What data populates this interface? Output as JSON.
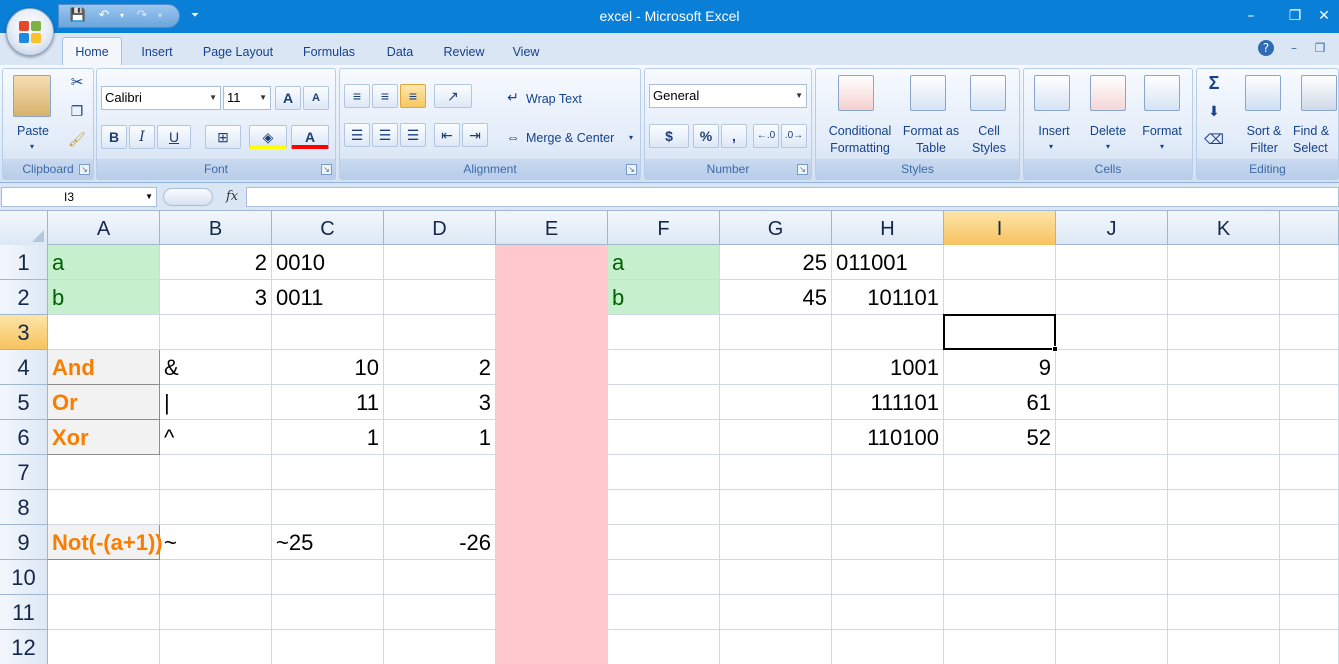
{
  "window": {
    "title": "excel - Microsoft Excel",
    "controls": {
      "minimize": "–",
      "restore": "❐",
      "close": "✕"
    }
  },
  "tabs": [
    "Home",
    "Insert",
    "Page Layout",
    "Formulas",
    "Data",
    "Review",
    "View"
  ],
  "active_tab": "Home",
  "ribbon": {
    "clipboard": {
      "paste": "Paste",
      "label": "Clipboard"
    },
    "font": {
      "name": "Calibri",
      "size": "11",
      "label": "Font",
      "bold": "B",
      "italic": "I",
      "underline": "U",
      "grow": "A",
      "shrink": "A"
    },
    "alignment": {
      "wrap": "Wrap Text",
      "merge": "Merge & Center",
      "label": "Alignment"
    },
    "number": {
      "format": "General",
      "currency": "$",
      "percent": "%",
      "comma": ",",
      "label": "Number"
    },
    "styles": {
      "conditional": "Conditional",
      "conditional2": "Formatting",
      "format_table": "Format as",
      "format_table2": "Table",
      "cell_styles": "Cell",
      "cell_styles2": "Styles",
      "label": "Styles"
    },
    "cells": {
      "insert": "Insert",
      "delete": "Delete",
      "format": "Format",
      "label": "Cells"
    },
    "editing": {
      "sigma": "Σ",
      "sort": "Sort &",
      "sort2": "Filter",
      "find": "Find &",
      "find2": "Select",
      "label": "Editing"
    }
  },
  "formula_bar": {
    "name_box": "I3",
    "fx": "fx",
    "content": ""
  },
  "colors": {
    "green_fill": "#c6efce",
    "green_text": "#006100",
    "pink_fill": "#ffc7ce",
    "orange_text": "#fa7d00",
    "title_bar": "#0a7fd8"
  },
  "grid": {
    "columns": [
      "A",
      "B",
      "C",
      "D",
      "E",
      "F",
      "G",
      "H",
      "I",
      "J",
      "K"
    ],
    "rows": [
      "1",
      "2",
      "3",
      "4",
      "5",
      "6",
      "7",
      "8",
      "9",
      "10",
      "11",
      "12"
    ],
    "selected_cell": "I3",
    "cells": {
      "A1": "a",
      "B1": "2",
      "C1": "0010",
      "F1": "a",
      "G1": "25",
      "H1": "011001",
      "A2": "b",
      "B2": "3",
      "C2": "0011",
      "F2": "b",
      "G2": "45",
      "H2": "101101",
      "A4": "And",
      "B4": "&",
      "C4": "10",
      "D4": "2",
      "H4": "1001",
      "I4": "9",
      "A5": "Or",
      "B5": "|",
      "C5": "11",
      "D5": "3",
      "H5": "111101",
      "I5": "61",
      "A6": "Xor",
      "B6": "^",
      "C6": "1",
      "D6": "1",
      "H6": "110100",
      "I6": "52",
      "A9": "Not(-(a+1))",
      "B9": "~",
      "C9": "~25",
      "D9": "-26"
    }
  }
}
